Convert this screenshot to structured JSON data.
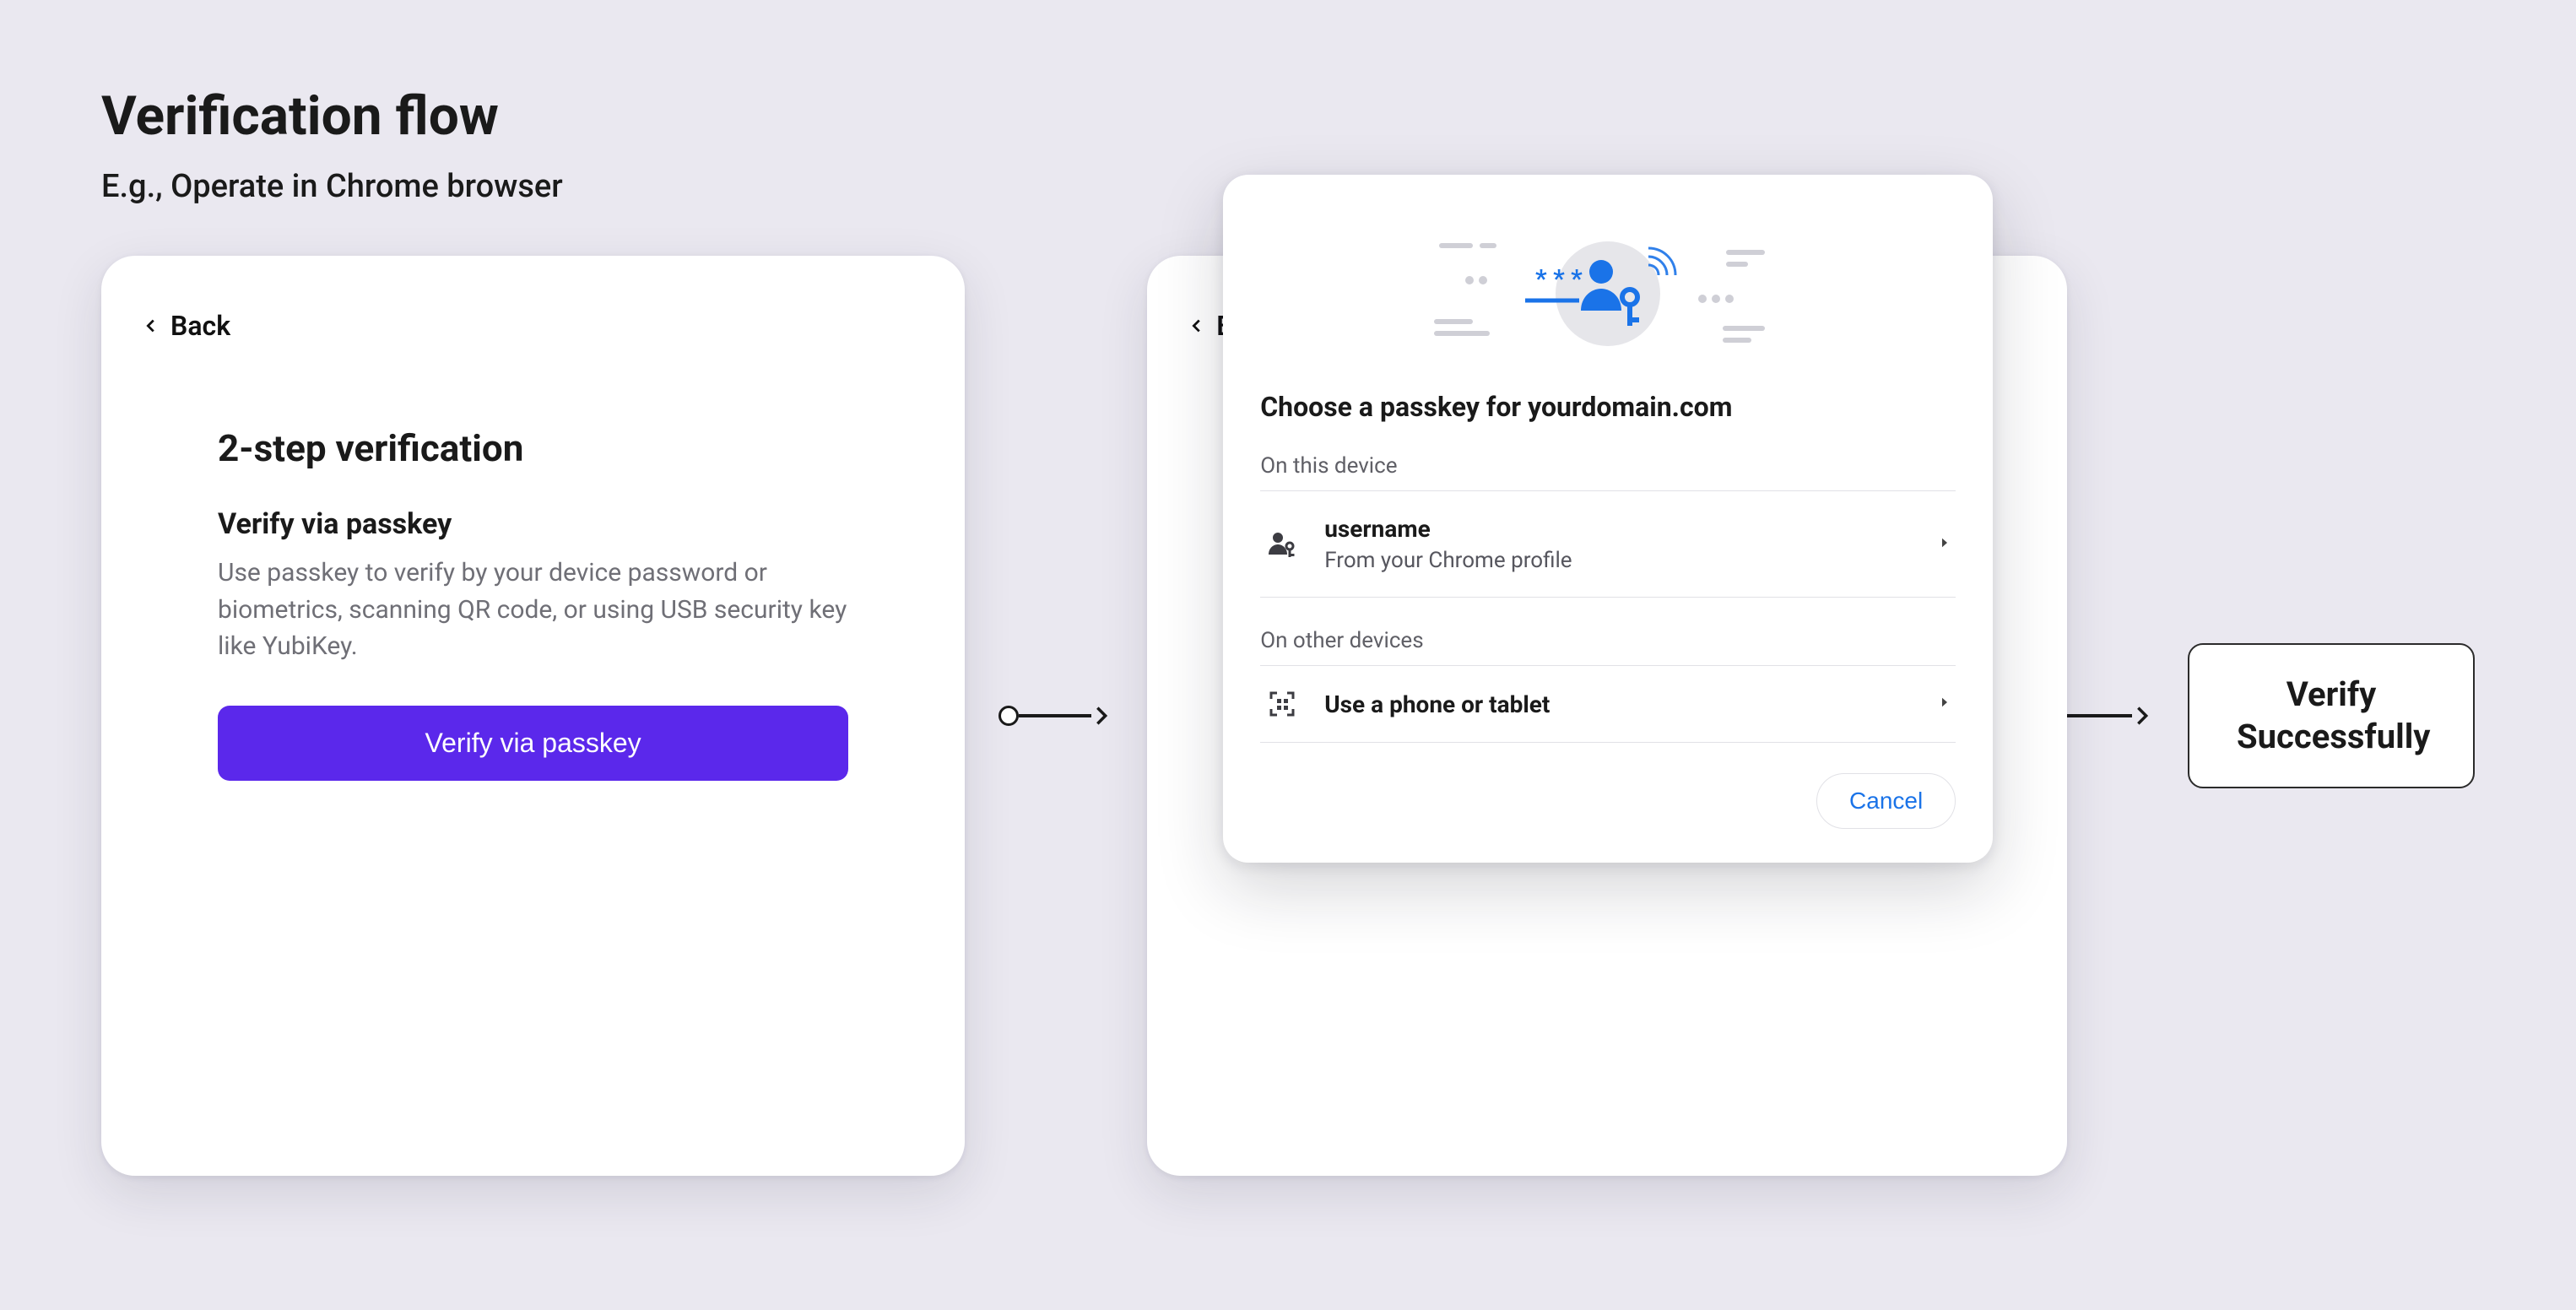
{
  "header": {
    "title": "Verification flow",
    "subtitle": "E.g., Operate in Chrome browser"
  },
  "step1": {
    "back_label": "Back",
    "title": "2-step verification",
    "lead": "Verify via passkey",
    "description": "Use passkey to verify by your device password or biometrics, scanning QR code, or using USB security key like YubiKey.",
    "cta": "Verify via passkey"
  },
  "step2": {
    "back_label": "Back",
    "popover": {
      "title_prefix": "Choose a passkey for",
      "domain": "yourdomain.com",
      "on_this_device_label": "On this device",
      "account": {
        "username": "username",
        "source": "From your Chrome profile"
      },
      "on_other_devices_label": "On other devices",
      "other_option": "Use a phone or tablet",
      "cancel": "Cancel"
    }
  },
  "result": {
    "line1": "Verify",
    "line2": "Successfully"
  },
  "colors": {
    "primary": "#5B28EB",
    "link_blue": "#1A73E8",
    "background": "#EAE8F0"
  }
}
